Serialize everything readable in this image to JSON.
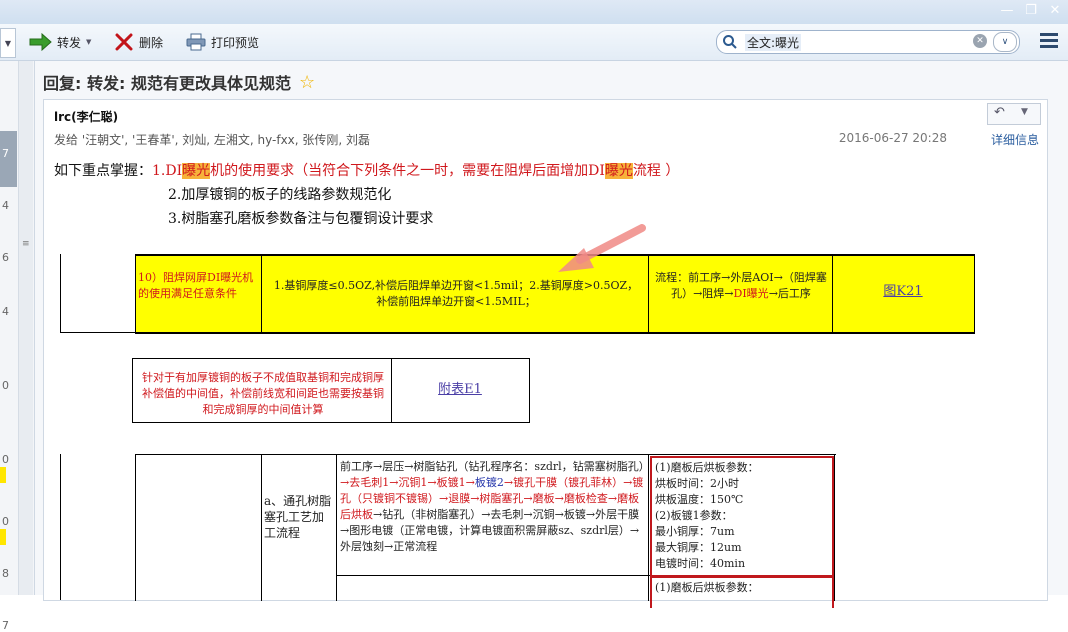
{
  "toolbar": {
    "forward_label": "转发",
    "delete_label": "删除",
    "print_label": "打印预览",
    "search_value": "全文:曝光"
  },
  "left": {
    "rows": [
      "7",
      "4",
      "6",
      "4",
      "0",
      "0",
      "0",
      "8",
      "7"
    ]
  },
  "message": {
    "subject": "回复: 转发: 规范有更改具体见规范",
    "sender": "lrc(李仁聪)",
    "recipients": "发给 '汪朝文', '王春革', 刘灿, 左湘文, hy-fxx, 张传刚, 刘磊",
    "date": "2016-06-27 20:28",
    "details_label": "详细信息"
  },
  "content": {
    "intro": "如下重点掌握：",
    "item1_a": "1.DI",
    "item1_hl1": "曝光",
    "item1_b": "机的使用要求（当符合下列条件之一时，需要在阻焊后面增加DI",
    "item1_hl2": "曝光",
    "item1_c": "流程 ）",
    "item2": "2.加厚镀铜的板子的线路参数规范化",
    "item3": "3.树脂塞孔磨板参数备注与包覆铜设计要求"
  },
  "table1": {
    "col1": "10）阻焊网屏DI曝光机的使用满足任意条件",
    "col2": "1.基铜厚度≤0.5OZ,补偿后阻焊单边开窗<1.5mil；2.基铜厚度>0.5OZ，补偿前阻焊单边开窗<1.5MIL；",
    "col3_a": "流程：前工序→外层AOI→（阻焊塞孔）→阻焊→",
    "col3_red": "DI曝光",
    "col3_b": "→后工序",
    "col4": "图K21"
  },
  "table2": {
    "text": "针对于有加厚镀铜的板子不成值取基铜和完成铜厚补偿值的中间值，补偿前线宽和间距也需要按基铜和完成铜厚的中间值计算",
    "link": "附表E1"
  },
  "table3": {
    "label": "a、通孔树脂塞孔工艺加工流程",
    "flow_a": "前工序→层压→树脂钻孔（钻孔程序名：szdrl，钻需塞树脂孔）",
    "flow_red1": "→去毛刺1→沉铜1→板镀1→",
    "flow_blue": "板镀2",
    "flow_red2": "→镀孔干膜（镀孔菲林）→镀孔（只镀铜不镀锡）→退膜→树脂塞孔→磨板→磨板检查→磨板后烘板",
    "flow_b": "→钻孔（非树脂塞孔）→去毛刺→沉铜→板镀→外层干膜→图形电镀（正常电镀，计算电镀面积需屏蔽sz、szdrl层）→外层蚀刻→正常流程",
    "params": [
      "(1)磨板后烘板参数：",
      "烘板时间：2小时",
      "烘板温度：150℃",
      "(2)板镀1参数：",
      "最小铜厚：7um",
      "最大铜厚：12um",
      "电镀时间：40min"
    ],
    "params2": "(1)磨板后烘板参数："
  },
  "colors": {
    "highlight_yellow": "#ffff00",
    "accent_red": "#d0181d",
    "link_purple": "#4b3fa6"
  }
}
